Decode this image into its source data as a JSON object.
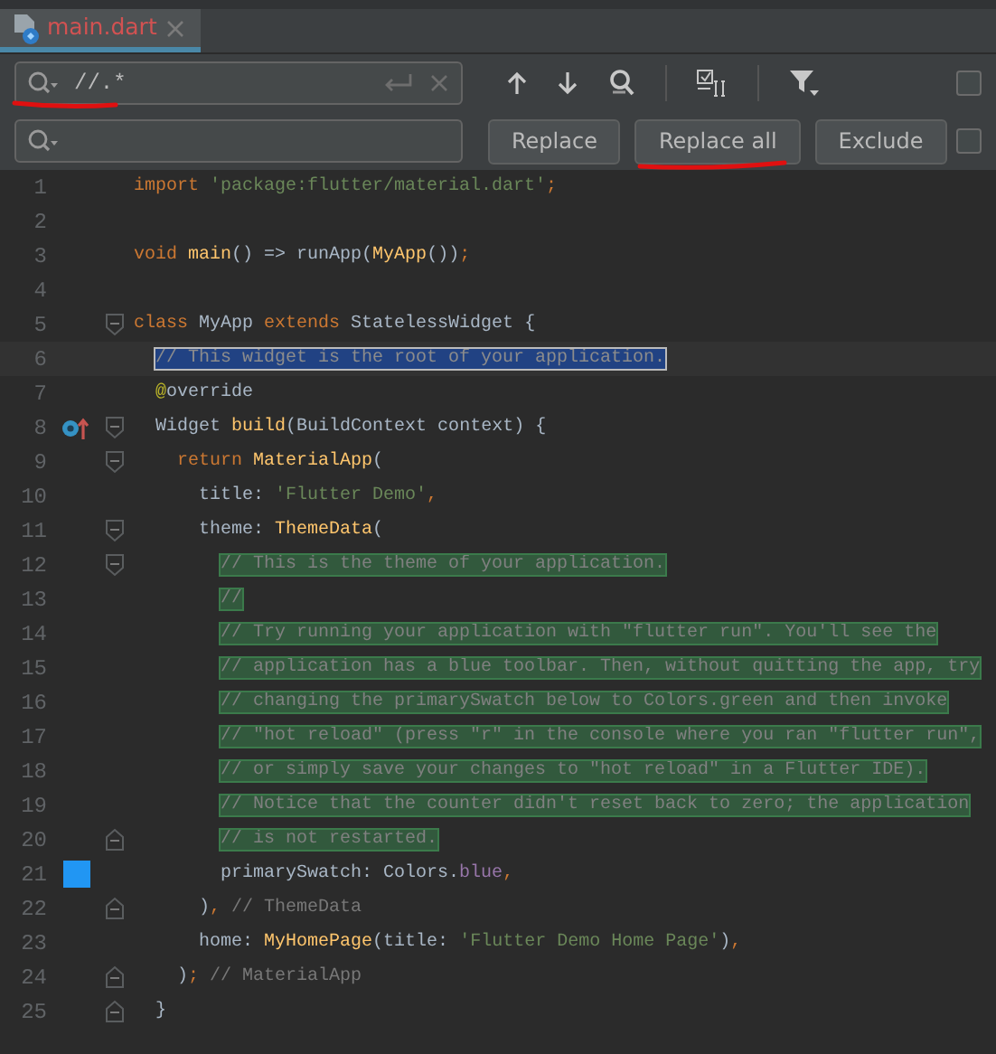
{
  "tab": {
    "title": "main.dart",
    "selected": true
  },
  "find": {
    "value": "//.*",
    "checked": false
  },
  "replace": {
    "checked": false
  },
  "replace_buttons": [
    "Replace",
    "Replace all",
    "Exclude"
  ],
  "lines": [
    {
      "number": "1",
      "tokens": [
        {
          "kind": "keyword",
          "text": "import "
        },
        {
          "kind": "string",
          "text": "'package:flutter/material.dart'"
        },
        {
          "kind": "keyword",
          "text": ";"
        }
      ]
    },
    {
      "number": "2"
    },
    {
      "number": "3",
      "tokens": [
        {
          "kind": "keyword",
          "text": "void "
        },
        {
          "kind": "function",
          "text": "main"
        },
        {
          "kind": "plain",
          "text": "() => runApp("
        },
        {
          "kind": "function",
          "text": "MyApp"
        },
        {
          "kind": "plain",
          "text": "())"
        },
        {
          "kind": "keyword",
          "text": ";"
        }
      ]
    },
    {
      "number": "4"
    },
    {
      "number": "5",
      "fold_start": true,
      "tokens": [
        {
          "kind": "keyword",
          "text": "class "
        },
        {
          "kind": "plain",
          "text": "MyApp "
        },
        {
          "kind": "keyword",
          "text": "extends "
        },
        {
          "kind": "plain",
          "text": "StatelessWidget {"
        }
      ]
    },
    {
      "number": "6",
      "highlighted": true,
      "current": true,
      "tokens": [
        {
          "kind": "comment",
          "text": "  // This widget is the root of your application."
        }
      ]
    },
    {
      "number": "7",
      "tokens": [
        {
          "kind": "annotation",
          "text": "  @"
        },
        {
          "kind": "plain",
          "text": "override"
        }
      ]
    },
    {
      "number": "8",
      "fold_start": true,
      "override": true,
      "tokens": [
        {
          "kind": "plain",
          "text": "  Widget "
        },
        {
          "kind": "function",
          "text": "build"
        },
        {
          "kind": "plain",
          "text": "(BuildContext context) {"
        }
      ]
    },
    {
      "number": "9",
      "fold_start": true,
      "tokens": [
        {
          "kind": "keyword",
          "text": "    return "
        },
        {
          "kind": "function",
          "text": "MaterialApp"
        },
        {
          "kind": "plain",
          "text": "("
        }
      ]
    },
    {
      "number": "10",
      "tokens": [
        {
          "kind": "plain",
          "text": "      title: "
        },
        {
          "kind": "string",
          "text": "'Flutter Demo'"
        },
        {
          "kind": "keyword",
          "text": ","
        }
      ]
    },
    {
      "number": "11",
      "fold_start": true,
      "tokens": [
        {
          "kind": "plain",
          "text": "      theme: "
        },
        {
          "kind": "function",
          "text": "ThemeData"
        },
        {
          "kind": "plain",
          "text": "("
        }
      ]
    },
    {
      "number": "12",
      "fold_start": true,
      "highlighted": true,
      "tokens": [
        {
          "kind": "comment",
          "text": "        // This is the theme of your application."
        }
      ]
    },
    {
      "number": "13",
      "highlighted": true,
      "tokens": [
        {
          "kind": "comment",
          "text": "        //"
        }
      ]
    },
    {
      "number": "14",
      "highlighted": true,
      "tokens": [
        {
          "kind": "comment",
          "text": "        // Try running your application with \"flutter run\". You'll see the"
        }
      ]
    },
    {
      "number": "15",
      "highlighted": true,
      "tokens": [
        {
          "kind": "comment",
          "text": "        // application has a blue toolbar. Then, without quitting the app, try"
        }
      ]
    },
    {
      "number": "16",
      "highlighted": true,
      "tokens": [
        {
          "kind": "comment",
          "text": "        // changing the primarySwatch below to Colors.green and then invoke"
        }
      ]
    },
    {
      "number": "17",
      "highlighted": true,
      "tokens": [
        {
          "kind": "comment",
          "text": "        // \"hot reload\" (press \"r\" in the console where you ran \"flutter run\","
        }
      ]
    },
    {
      "number": "18",
      "highlighted": true,
      "tokens": [
        {
          "kind": "comment",
          "text": "        // or simply save your changes to \"hot reload\" in a Flutter IDE)."
        }
      ]
    },
    {
      "number": "19",
      "highlighted": true,
      "tokens": [
        {
          "kind": "comment",
          "text": "        // Notice that the counter didn't reset back to zero; the application"
        }
      ]
    },
    {
      "number": "20",
      "fold_end": true,
      "highlighted": true,
      "tokens": [
        {
          "kind": "comment",
          "text": "        // is not restarted."
        }
      ]
    },
    {
      "number": "21",
      "color": "#2196f3",
      "tokens": [
        {
          "kind": "plain",
          "text": "        primarySwatch: Colors."
        },
        {
          "kind": "field",
          "text": "blue"
        },
        {
          "kind": "keyword",
          "text": ","
        }
      ]
    },
    {
      "number": "22",
      "fold_end": true,
      "tokens": [
        {
          "kind": "plain",
          "text": "      )"
        },
        {
          "kind": "keyword",
          "text": ", "
        },
        {
          "kind": "hint",
          "text": "// ThemeData"
        }
      ]
    },
    {
      "number": "23",
      "tokens": [
        {
          "kind": "plain",
          "text": "      home: "
        },
        {
          "kind": "function",
          "text": "MyHomePage"
        },
        {
          "kind": "plain",
          "text": "(title: "
        },
        {
          "kind": "string",
          "text": "'Flutter Demo Home Page'"
        },
        {
          "kind": "plain",
          "text": ")"
        },
        {
          "kind": "keyword",
          "text": ","
        }
      ]
    },
    {
      "number": "24",
      "fold_end": true,
      "tokens": [
        {
          "kind": "plain",
          "text": "    )"
        },
        {
          "kind": "keyword",
          "text": "; "
        },
        {
          "kind": "hint",
          "text": "// MaterialApp"
        }
      ]
    },
    {
      "number": "25",
      "fold_end": true,
      "tokens": [
        {
          "kind": "plain",
          "text": "  }"
        }
      ]
    }
  ]
}
